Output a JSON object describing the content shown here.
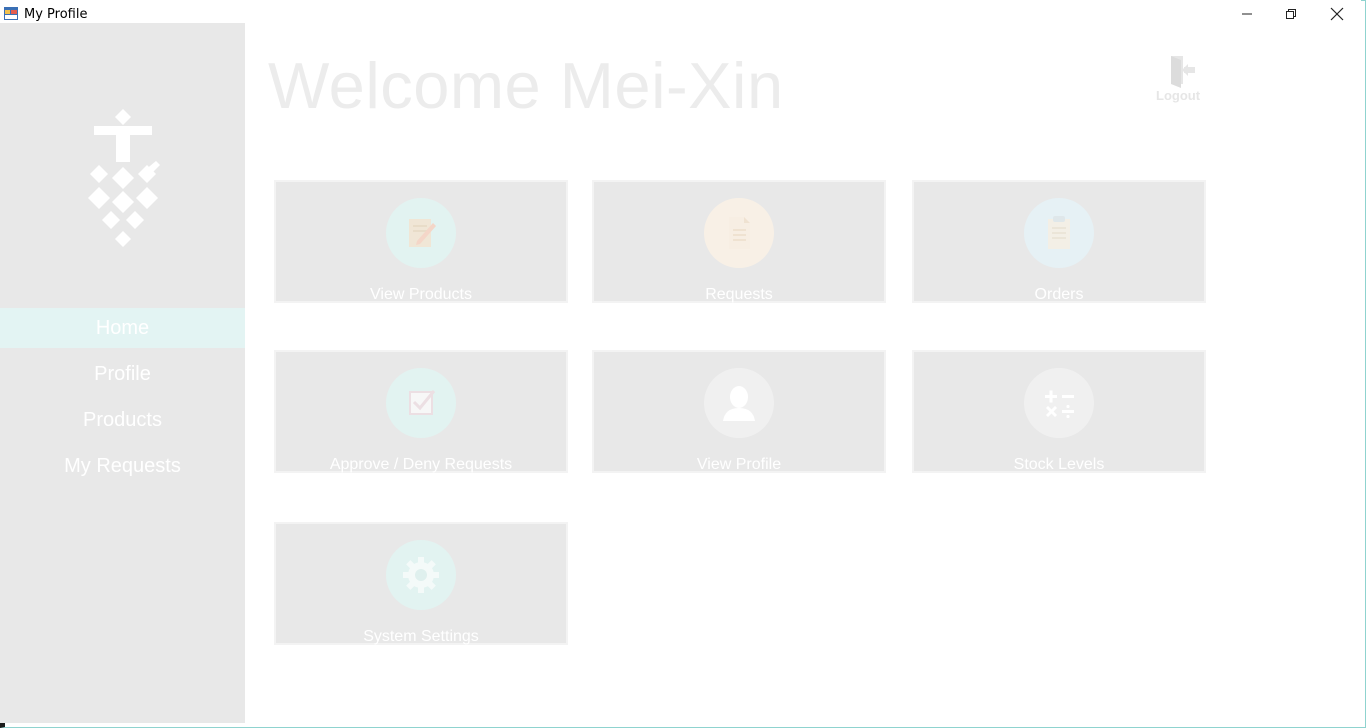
{
  "window": {
    "title": "My Profile"
  },
  "sidebar": {
    "items": [
      {
        "label": "Home",
        "active": true
      },
      {
        "label": "Profile",
        "active": false
      },
      {
        "label": "Products",
        "active": false
      },
      {
        "label": "My Requests",
        "active": false
      }
    ]
  },
  "header": {
    "welcome": "Welcome Mei-Xin",
    "logout_label": "Logout"
  },
  "tiles": [
    {
      "label": "View Products",
      "icon": "edit-document-icon"
    },
    {
      "label": "Requests",
      "icon": "document-icon"
    },
    {
      "label": "Orders",
      "icon": "clipboard-icon"
    },
    {
      "label": "Approve / Deny Requests",
      "icon": "checkbox-icon"
    },
    {
      "label": "View Profile",
      "icon": "user-icon"
    },
    {
      "label": "Stock Levels",
      "icon": "calculator-icon"
    },
    {
      "label": "System Settings",
      "icon": "gear-icon"
    }
  ],
  "colors": {
    "accent": "#1aa39a",
    "sidebar_bg": "#e8e8e8",
    "tile_bg": "#e8e8e8"
  }
}
